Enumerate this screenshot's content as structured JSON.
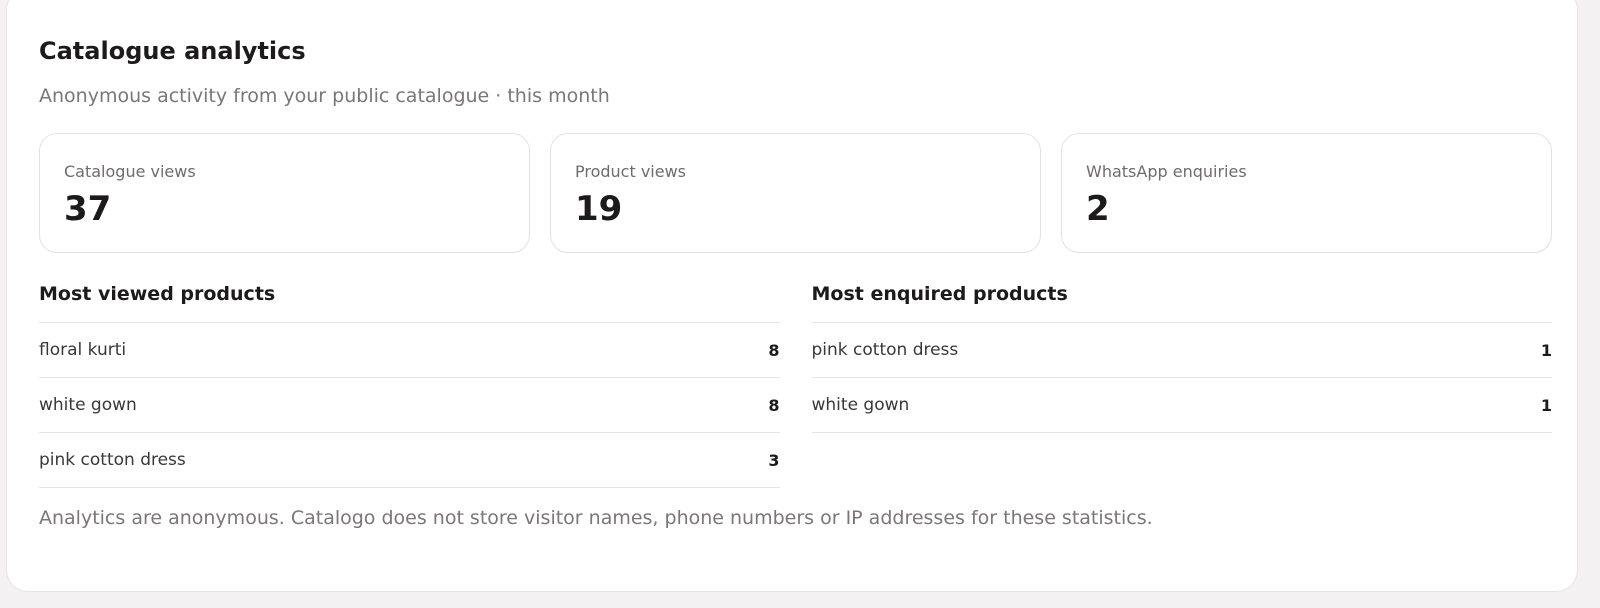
{
  "analytics": {
    "title": "Catalogue analytics",
    "subtitle": "Anonymous activity from your public catalogue · this month",
    "stats": [
      {
        "label": "Catalogue views",
        "value": "37"
      },
      {
        "label": "Product views",
        "value": "19"
      },
      {
        "label": "WhatsApp enquiries",
        "value": "2"
      }
    ],
    "most_viewed": {
      "title": "Most viewed products",
      "rows": [
        {
          "name": "floral kurti",
          "count": "8"
        },
        {
          "name": "white gown",
          "count": "8"
        },
        {
          "name": "pink cotton dress",
          "count": "3"
        }
      ]
    },
    "most_enquired": {
      "title": "Most enquired products",
      "rows": [
        {
          "name": "pink cotton dress",
          "count": "1"
        },
        {
          "name": "white gown",
          "count": "1"
        }
      ]
    },
    "footnote": "Analytics are anonymous. Catalogo does not store visitor names, phone numbers or IP addresses for these statistics."
  }
}
